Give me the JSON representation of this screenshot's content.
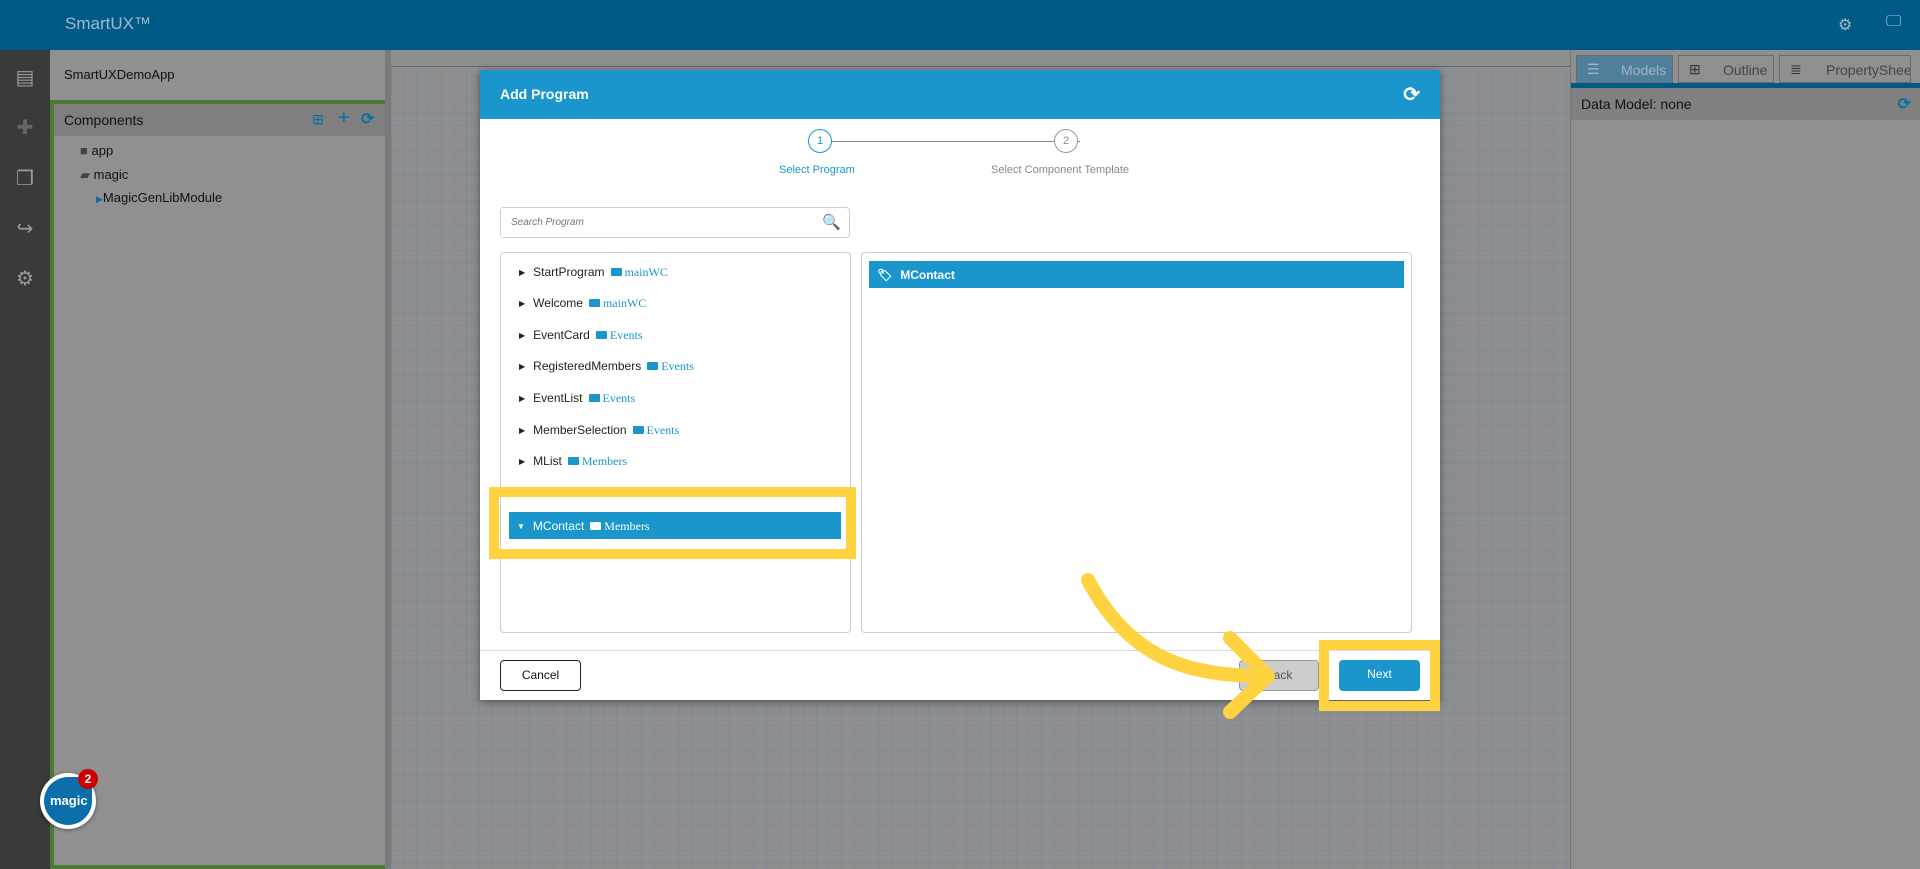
{
  "app": {
    "title": "SmartUX™",
    "project": "SmartUXDemoApp"
  },
  "components": {
    "title": "Components",
    "tree": [
      {
        "label": "app"
      },
      {
        "label": "magic"
      },
      {
        "label": "MagicGenLibModule"
      }
    ]
  },
  "right_panel": {
    "tabs": [
      {
        "label": "Models"
      },
      {
        "label": "Outline"
      },
      {
        "label": "PropertyShee"
      }
    ],
    "data_model": "Data Model: none"
  },
  "dialog": {
    "title": "Add Program",
    "steps": [
      {
        "num": "1",
        "label": "Select Program"
      },
      {
        "num": "2",
        "label": "Select Component Template"
      }
    ],
    "search_placeholder": "Search Program",
    "programs": [
      {
        "name": "StartProgram",
        "folder": "mainWC"
      },
      {
        "name": "Welcome",
        "folder": "mainWC"
      },
      {
        "name": "EventCard",
        "folder": "Events"
      },
      {
        "name": "RegisteredMembers",
        "folder": "Events"
      },
      {
        "name": "EventList",
        "folder": "Events"
      },
      {
        "name": "MemberSelection",
        "folder": "Events"
      },
      {
        "name": "MList",
        "folder": "Members"
      }
    ],
    "selected_program": {
      "name": "MContact",
      "folder": "Members"
    },
    "forms": [
      {
        "name": "MContact"
      }
    ],
    "buttons": {
      "cancel": "Cancel",
      "back": "Back",
      "next": "Next"
    }
  },
  "badge": {
    "count": "2",
    "logo": "magic"
  },
  "colors": {
    "accent": "#1a96cc",
    "topbar": "#005a87",
    "highlight": "#ffd23f"
  }
}
